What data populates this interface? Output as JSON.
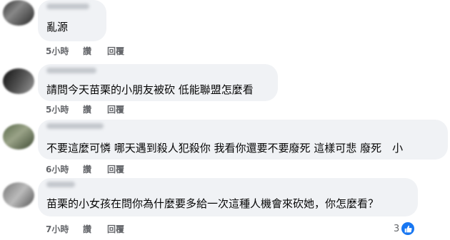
{
  "comments": [
    {
      "text": "亂源",
      "time": "5小時",
      "like_label": "讚",
      "reply_label": "回覆"
    },
    {
      "text": "請問今天苗栗的小朋友被砍 低能聯盟怎麼看",
      "time": "5小時",
      "like_label": "讚",
      "reply_label": "回覆"
    },
    {
      "text": "不要這麼可憐 哪天遇到殺人犯殺你 我看你還要不要廢死 這樣可悲 廢死　小",
      "time": "6小時",
      "like_label": "讚",
      "reply_label": "回覆"
    },
    {
      "text": "苗栗的小女孩在問你為什麼要多給一次這種人機會來砍她，你怎麼看？",
      "time": "7小時",
      "like_label": "讚",
      "reply_label": "回覆",
      "reaction_count": "3"
    }
  ],
  "icons": {
    "reaction": "like-thumb-icon",
    "reaction_color": "#1877f2"
  }
}
